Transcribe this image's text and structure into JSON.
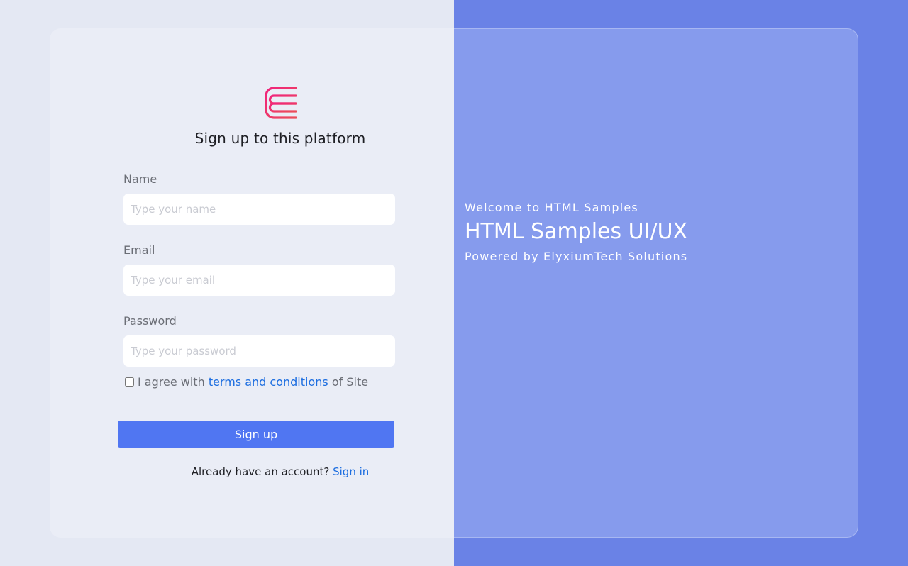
{
  "brand": {
    "logo_icon": "elyxium-logo-icon",
    "gradient": [
      "#f0237c",
      "#e8314a"
    ]
  },
  "form": {
    "title": "Sign up to this platform",
    "name_label": "Name",
    "name_placeholder": "Type your name",
    "email_label": "Email",
    "email_placeholder": "Type your email",
    "password_label": "Password",
    "password_placeholder": "Type your password",
    "agree_prefix": "I agree with",
    "agree_link": "terms and conditions",
    "agree_suffix": "of Site",
    "submit_label": "Sign up",
    "already_text": "Already have an account?",
    "signin_link": "Sign in"
  },
  "hero": {
    "welcome": "Welcome to HTML Samples",
    "title": "HTML Samples UI/UX",
    "powered": "Powered by ElyxiumTech Solutions"
  },
  "colors": {
    "accent": "#5076f2",
    "link": "#1d6ee0",
    "panel": "#869bed",
    "background_right": "#6a82e6"
  }
}
